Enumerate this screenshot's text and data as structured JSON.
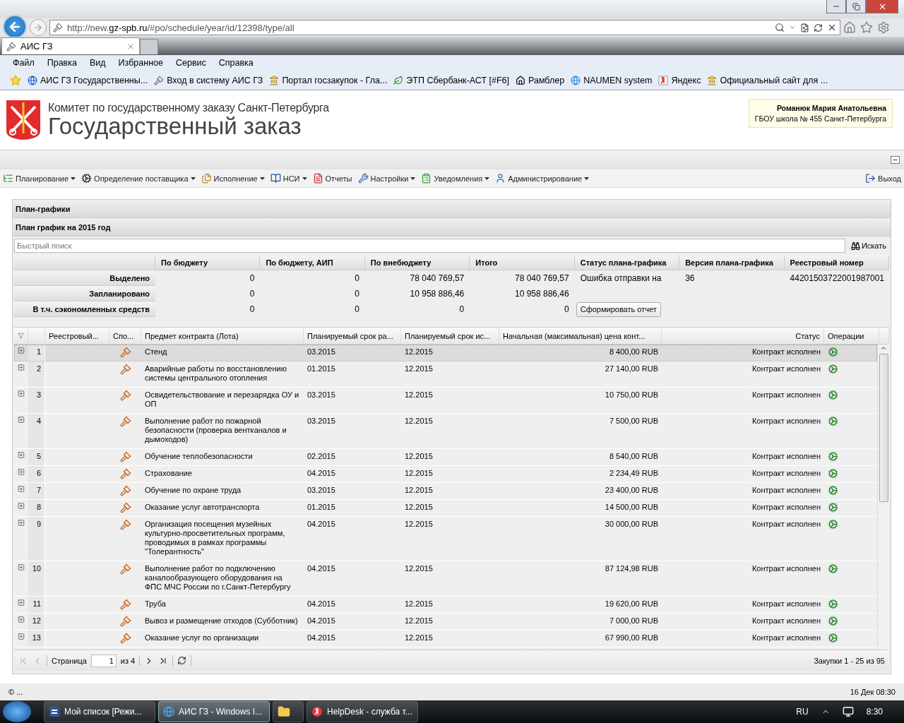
{
  "browser": {
    "address": "http://new.**gz-spb.ru**/#po/schedule/year/id/12398/type/all",
    "tab": "АИС ГЗ",
    "menu": [
      "Файл",
      "Правка",
      "Вид",
      "Избранное",
      "Сервис",
      "Справка"
    ],
    "favorites": [
      {
        "label": "АИС ГЗ  Государственны...",
        "kind": "site"
      },
      {
        "label": "Вход в систему  АИС ГЗ",
        "kind": "gavel"
      },
      {
        "label": "Портал госзакупок - Гла...",
        "kind": "emblem"
      },
      {
        "label": "ЭТП Сбербанк-АСТ [#F6]",
        "kind": "bank"
      },
      {
        "label": "Рамблер",
        "kind": "home"
      },
      {
        "label": "NAUMEN system",
        "kind": "ie"
      },
      {
        "label": "Яндекс",
        "kind": "yandex"
      },
      {
        "label": "Официальный сайт для ...",
        "kind": "emblem"
      }
    ]
  },
  "header": {
    "committee": "Комитет по государственному заказу Санкт-Петербурга",
    "title": "Государственный заказ",
    "user": {
      "name": "Романюк Мария Анатольевна",
      "organization": "ГБОУ школа № 455 Санкт-Петербурга"
    }
  },
  "nav": {
    "items": [
      {
        "label": "Планирование",
        "dropdown": true
      },
      {
        "label": "Определение поставщика",
        "dropdown": true
      },
      {
        "label": "Исполнение",
        "dropdown": true
      },
      {
        "label": "НСИ",
        "dropdown": true
      },
      {
        "label": "Отчеты",
        "dropdown": false
      },
      {
        "label": "Настройки",
        "dropdown": true
      },
      {
        "label": "Уведомления",
        "dropdown": true
      },
      {
        "label": "Администрирование",
        "dropdown": true
      }
    ],
    "logout": "Выход"
  },
  "panel": {
    "title": "План-графики",
    "subtitle": "План график на 2015 год",
    "search": {
      "placeholder": "Быстрый поиск",
      "button": "Искать"
    }
  },
  "summary": {
    "columns": [
      "По бюджету",
      "По бюджету, АИП",
      "По внебюджету",
      "Итого",
      "Статус плана-графика",
      "Версия плана-графика",
      "Реестровый номер"
    ],
    "rows": [
      {
        "label": "Выделено",
        "cells": [
          "0",
          "0",
          "78 040 769,57",
          "78 040 769,57",
          "Ошибка отправки на",
          "36",
          "44201503722001987001"
        ]
      },
      {
        "label": "Запланировано",
        "cells": [
          "0",
          "0",
          "10 958 886,46",
          "10 958 886,46"
        ]
      },
      {
        "label": "В т.ч. сэкономленных средств",
        "cells": [
          "0",
          "0",
          "0",
          "0"
        ],
        "button": "Сформировать отчет"
      }
    ]
  },
  "grid": {
    "columns": [
      "Реестровый...",
      "Спо...",
      "Предмет контракта (Лота)",
      "Планируемый срок ра...",
      "Планируемый срок ис...",
      "Начальная (максимальная) цена конт...",
      "Статус",
      "Операции"
    ],
    "rows": [
      {
        "number": "1",
        "subject": "Стенд",
        "start": "03.2015",
        "end": "12.2015",
        "price": "8 400,00 RUB",
        "status": "Контракт исполнен",
        "selected": true
      },
      {
        "number": "2",
        "subject": "Аварийные работы по восстановлению системы центрального отопления",
        "start": "01.2015",
        "end": "12.2015",
        "price": "27 140,00 RUB",
        "status": "Контракт исполнен",
        "selected": false
      },
      {
        "number": "3",
        "subject": "Освидетельствование и перезарядка ОУ и ОП",
        "start": "03.2015",
        "end": "12.2015",
        "price": "10 750,00 RUB",
        "status": "Контракт исполнен",
        "selected": false
      },
      {
        "number": "4",
        "subject": "Выполнение работ по пожарной безопасности (проверка вентканалов и дымоходов)",
        "start": "03.2015",
        "end": "12.2015",
        "price": "7 500,00 RUB",
        "status": "Контракт исполнен",
        "selected": false
      },
      {
        "number": "5",
        "subject": "Обучение теплобезопасности",
        "start": "02.2015",
        "end": "12.2015",
        "price": "8 540,00 RUB",
        "status": "Контракт исполнен",
        "selected": false
      },
      {
        "number": "6",
        "subject": "Страхование",
        "start": "04.2015",
        "end": "12.2015",
        "price": "2 234,49 RUB",
        "status": "Контракт исполнен",
        "selected": false
      },
      {
        "number": "7",
        "subject": "Обучение по охране труда",
        "start": "03.2015",
        "end": "12.2015",
        "price": "23 400,00 RUB",
        "status": "Контракт исполнен",
        "selected": false
      },
      {
        "number": "8",
        "subject": "Оказание услуг автотранспорта",
        "start": "01.2015",
        "end": "12.2015",
        "price": "14 500,00 RUB",
        "status": "Контракт исполнен",
        "selected": false
      },
      {
        "number": "9",
        "subject": "Организация посещения музейных культурно-просветительных программ, проводимых в рамках программы \"Толерантность\"",
        "start": "04.2015",
        "end": "12.2015",
        "price": "30 000,00 RUB",
        "status": "Контракт исполнен",
        "selected": false
      },
      {
        "number": "10",
        "subject": "Выполнение работ по подключению каналообразующего оборудования на ФПС МЧС России по г.Санкт-Петербургу",
        "start": "04.2015",
        "end": "12.2015",
        "price": "87 124,98 RUB",
        "status": "Контракт исполнен",
        "selected": false
      },
      {
        "number": "11",
        "subject": "Труба",
        "start": "04.2015",
        "end": "12.2015",
        "price": "19 620,00 RUB",
        "status": "Контракт исполнен",
        "selected": false
      },
      {
        "number": "12",
        "subject": "Вывоз и размещение отходов (Субботник)",
        "start": "04.2015",
        "end": "12.2015",
        "price": "7 000,00 RUB",
        "status": "Контракт исполнен",
        "selected": false
      },
      {
        "number": "13",
        "subject": "Оказание услуг по организации",
        "start": "04.2015",
        "end": "12.2015",
        "price": "67 990,00 RUB",
        "status": "Контракт исполнен",
        "selected": false
      }
    ],
    "pager": {
      "page_label": "Страница",
      "page": "1",
      "of": "из 4",
      "summary": "Закупки 1 - 25 из 95"
    }
  },
  "status_bar": {
    "left": "© ...",
    "right": "16 Дек 08:30"
  },
  "taskbar": {
    "buttons": [
      {
        "label": "Мой список [Режи...",
        "kind": "word",
        "selected": false
      },
      {
        "label": "АИС ГЗ - Windows I...",
        "kind": "ie",
        "selected": true
      },
      {
        "kind": "folder",
        "selected": false
      },
      {
        "label": "HelpDesk - служба т...",
        "kind": "yandex",
        "selected": false
      }
    ],
    "language": "RU",
    "time": "8:30"
  }
}
